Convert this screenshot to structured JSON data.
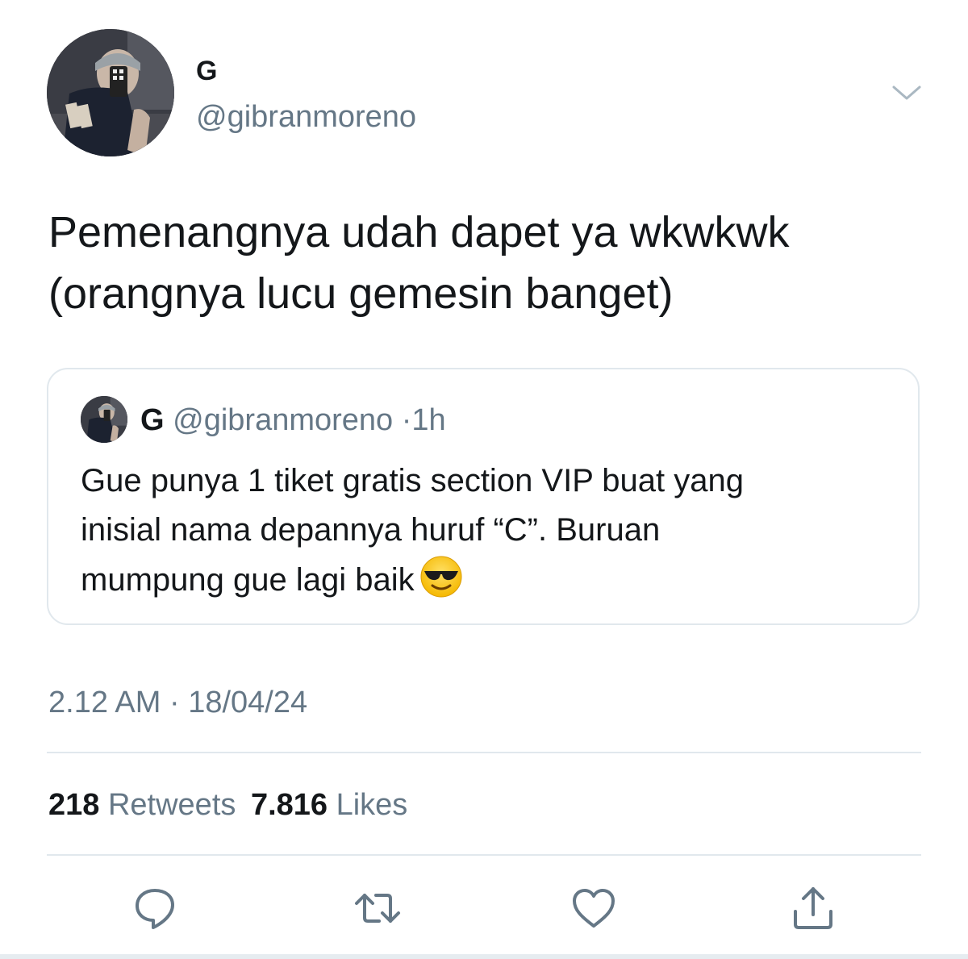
{
  "author": {
    "name": "G",
    "handle": "@gibranmoreno"
  },
  "tweet": {
    "text_line1": "Pemenangnya udah dapet ya wkwkwk",
    "text_line2": "(orangnya lucu gemesin banget)"
  },
  "quoted_tweet": {
    "name": "G",
    "handle": "@gibranmoreno",
    "separator": "·",
    "time": "1h",
    "text_line1": "Gue punya 1 tiket gratis section VIP buat yang",
    "text_line2": "inisial nama depannya huruf “C”. Buruan",
    "text_line3": "mumpung gue lagi baik",
    "emoji": "smiling-face-with-sunglasses"
  },
  "meta": {
    "time": "2.12 AM",
    "separator": "·",
    "date": "18/04/24"
  },
  "stats": {
    "retweets_count": "218",
    "retweets_label": "Retweets",
    "likes_count": "7.816",
    "likes_label": "Likes"
  },
  "actions": [
    "reply-icon",
    "retweet-icon",
    "like-icon",
    "share-icon"
  ],
  "colors": {
    "primary_text": "#14171a",
    "secondary_text": "#657786",
    "border": "#e1e8ed",
    "icon": "#657786"
  }
}
